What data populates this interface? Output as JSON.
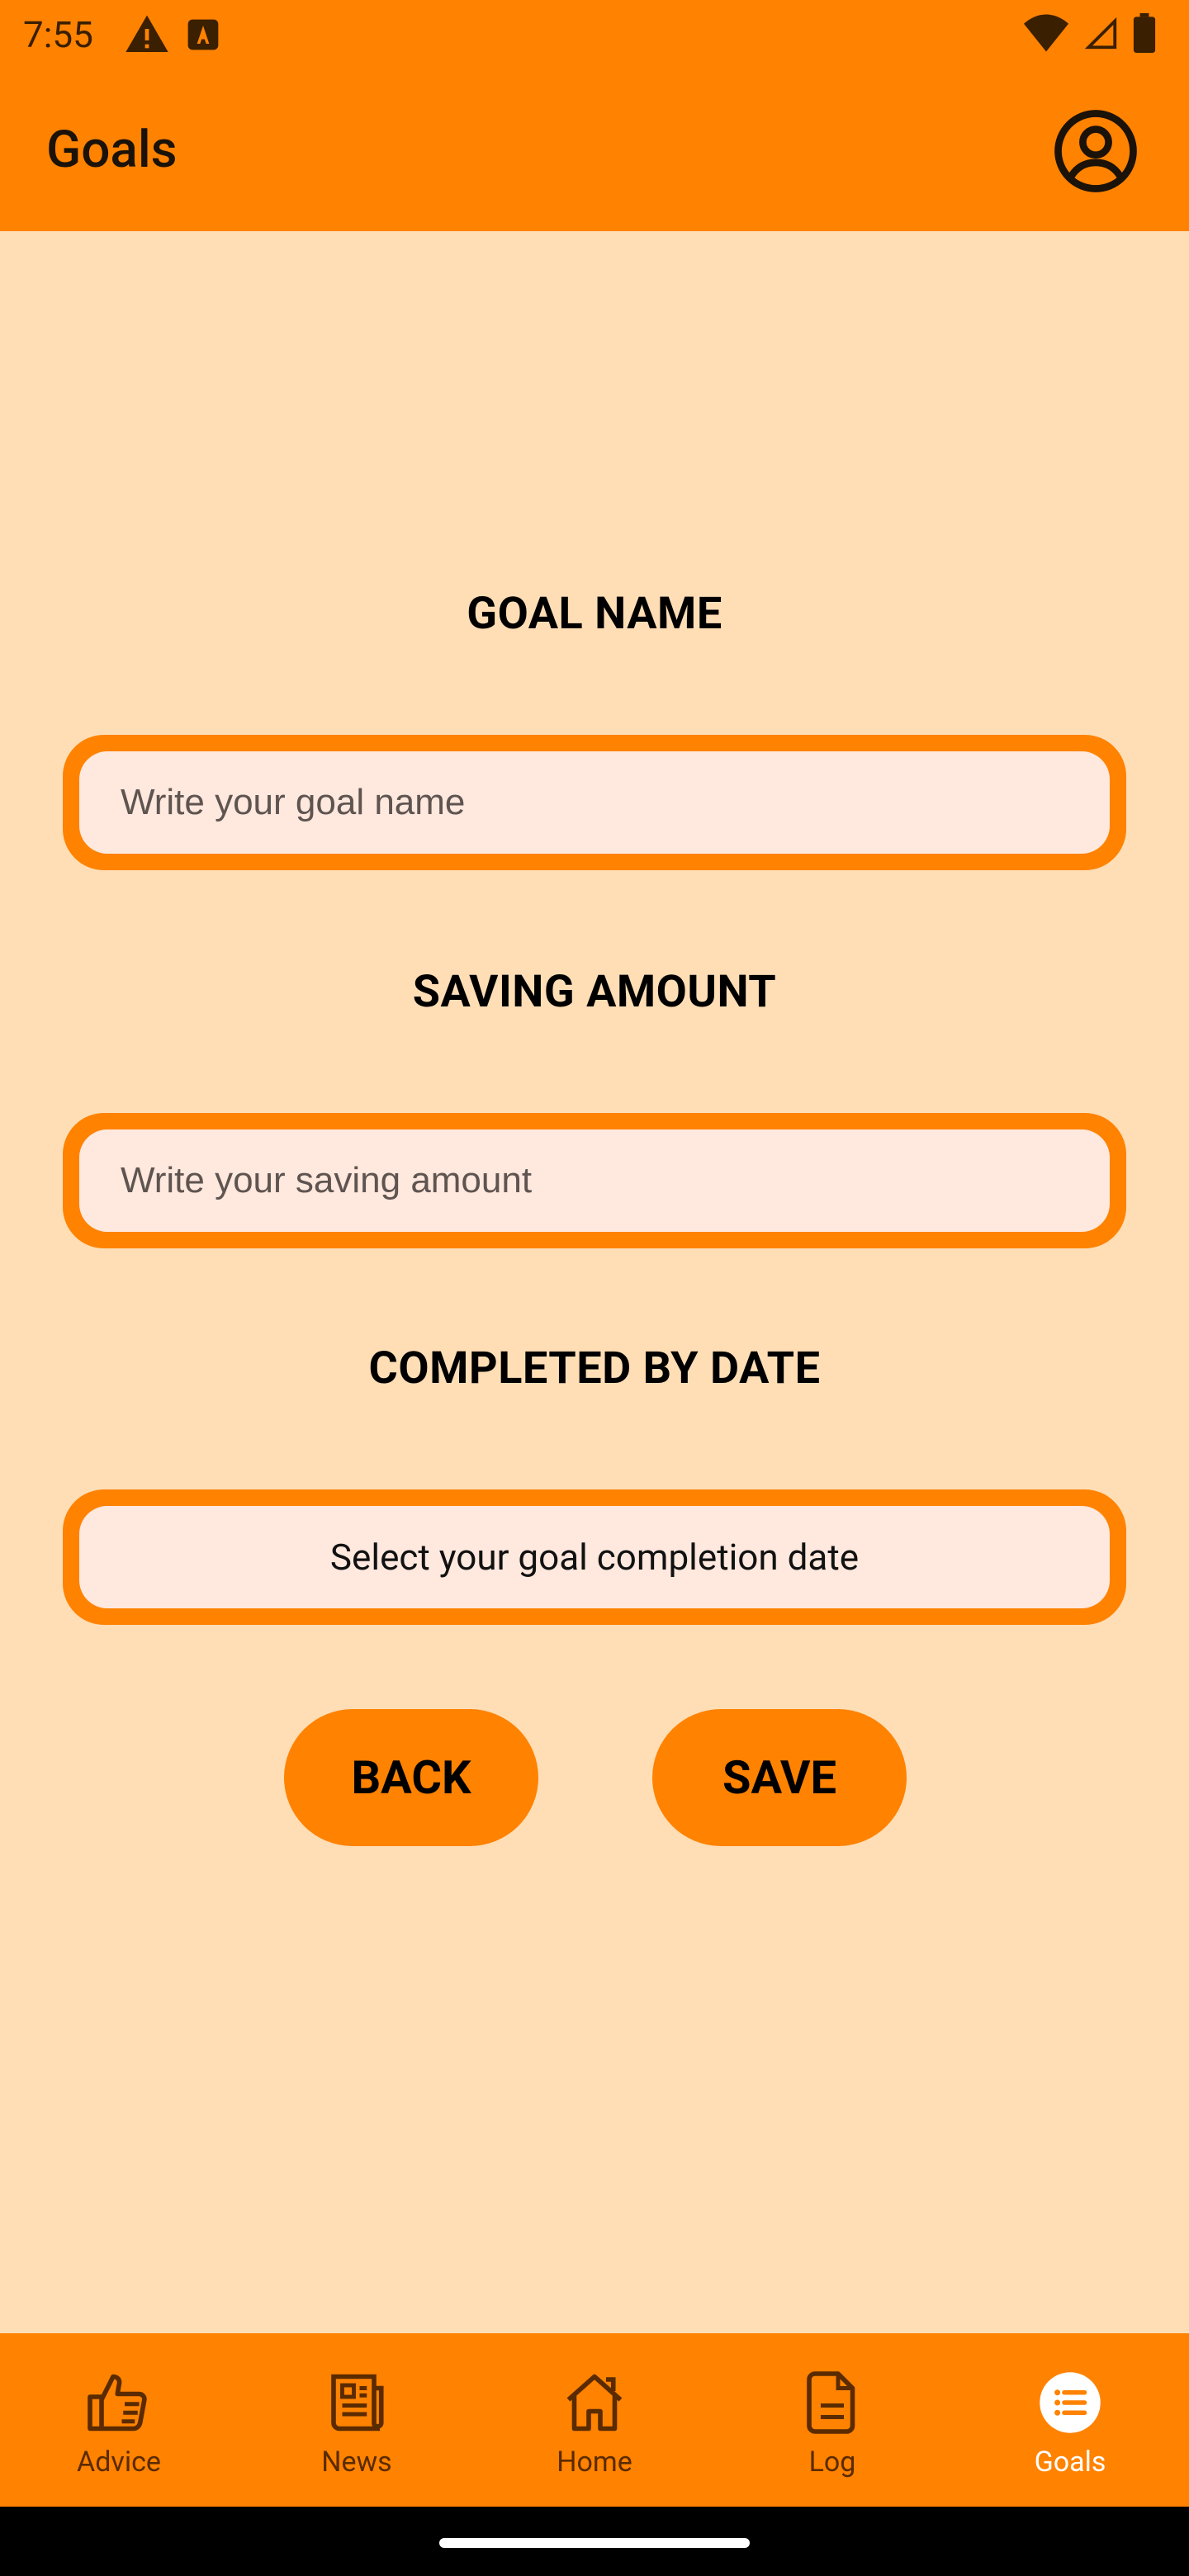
{
  "status_bar": {
    "time": "7:55",
    "icons_left": [
      "warning-icon",
      "a11y-a-icon"
    ],
    "icons_right": [
      "wifi-icon",
      "signal-icon",
      "battery-icon"
    ]
  },
  "app_bar": {
    "title": "Goals",
    "profile_icon": "account-circle-icon"
  },
  "form": {
    "goal_name_label": "GOAL NAME",
    "goal_name_placeholder": "Write your goal name",
    "saving_amount_label": "SAVING AMOUNT",
    "saving_amount_placeholder": "Write your saving amount",
    "completed_label": "COMPLETED BY DATE",
    "completed_button": "Select your goal completion date"
  },
  "actions": {
    "back_label": "BACK",
    "save_label": "SAVE"
  },
  "bottom_nav": {
    "items": [
      {
        "label": "Advice",
        "icon": "thumbs-up-icon",
        "active": false
      },
      {
        "label": "News",
        "icon": "newspaper-icon",
        "active": false
      },
      {
        "label": "Home",
        "icon": "home-icon",
        "active": false
      },
      {
        "label": "Log",
        "icon": "document-icon",
        "active": false
      },
      {
        "label": "Goals",
        "icon": "list-circle-icon",
        "active": true
      }
    ]
  },
  "colors": {
    "primary": "#FF8200",
    "background": "#FFDEB6",
    "field_fill": "#FFE8DE",
    "active_nav": "#FFFFFF"
  }
}
